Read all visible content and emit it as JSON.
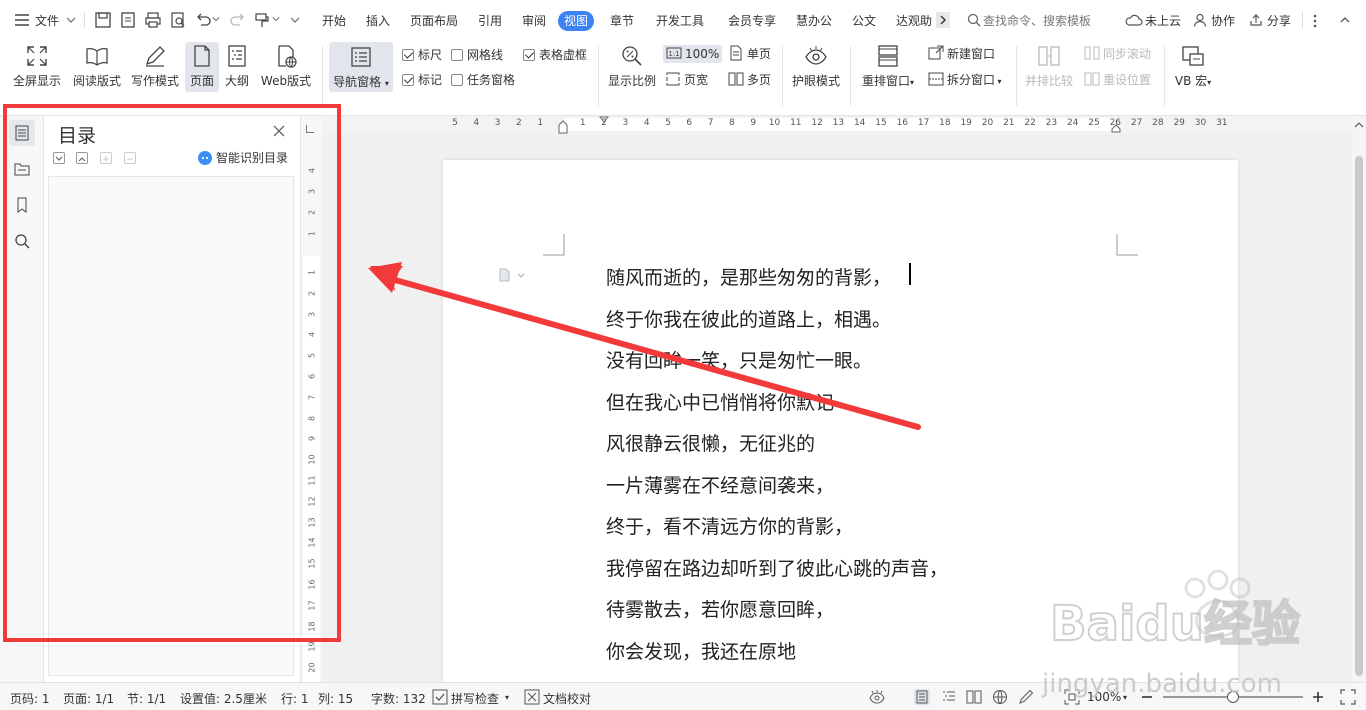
{
  "menubar": {
    "file_menu": "文件",
    "tabs": [
      {
        "label": "开始",
        "active": false
      },
      {
        "label": "插入",
        "active": false
      },
      {
        "label": "页面布局",
        "active": false
      },
      {
        "label": "引用",
        "active": false
      },
      {
        "label": "审阅",
        "active": false
      },
      {
        "label": "视图",
        "active": true
      },
      {
        "label": "章节",
        "active": false
      },
      {
        "label": "开发工具",
        "active": false
      },
      {
        "label": "会员专享",
        "active": false
      },
      {
        "label": "慧办公",
        "active": false
      },
      {
        "label": "公文",
        "active": false
      },
      {
        "label": "达观助",
        "active": false
      }
    ],
    "search_placeholder": "查找命令、搜索模板",
    "cloud_status": "未上云",
    "collaborate": "协作",
    "share": "分享"
  },
  "ribbon": {
    "fullscreen": "全屏显示",
    "reading_layout": "阅读版式",
    "writing_mode": "写作模式",
    "page_view": "页面",
    "outline": "大纲",
    "web_layout": "Web版式",
    "nav_pane": "导航窗格",
    "checks": {
      "ruler": {
        "label": "标尺",
        "checked": true
      },
      "gridlines": {
        "label": "网格线",
        "checked": false
      },
      "table_gridlines": {
        "label": "表格虚框",
        "checked": true
      },
      "marks": {
        "label": "标记",
        "checked": true
      },
      "task_pane": {
        "label": "任务窗格",
        "checked": false
      }
    },
    "zoom_ratio": "显示比例",
    "zoom_100": "100%",
    "page_width": "页宽",
    "single_page": "单页",
    "multi_page": "多页",
    "eye_protect": "护眼模式",
    "rearrange": "重排窗口",
    "new_window": "新建窗口",
    "split_window": "拆分窗口",
    "side_by_side": "并排比较",
    "sync_scroll": "同步滚动",
    "reset_position": "重设位置",
    "macro": "VB 宏"
  },
  "toc_panel": {
    "title": "目录",
    "smart_detect": "智能识别目录"
  },
  "ruler": {
    "horizontal": [
      "5",
      "4",
      "3",
      "2",
      "1",
      "",
      "1",
      "2",
      "3",
      "4",
      "5",
      "6",
      "7",
      "8",
      "9",
      "10",
      "11",
      "12",
      "13",
      "14",
      "15",
      "16",
      "17",
      "18",
      "19",
      "20",
      "21",
      "22",
      "23",
      "24",
      "25",
      "26",
      "27",
      "28",
      "29",
      "30",
      "31"
    ],
    "vertical_top": [
      "4",
      "3",
      "2",
      "1"
    ],
    "vertical_main": [
      "1",
      "2",
      "3",
      "4",
      "5",
      "6",
      "7",
      "8",
      "9",
      "10",
      "11",
      "12",
      "13",
      "14",
      "15",
      "16",
      "17",
      "18",
      "19",
      "20"
    ]
  },
  "document": {
    "lines": [
      "随风而逝的，是那些匆匆的背影，",
      "终于你我在彼此的道路上，相遇。",
      "没有回眸一笑，只是匆忙一眼。",
      "但在我心中已悄悄将你默记",
      "风很静云很懒，无征兆的",
      "一片薄雾在不经意间袭来，",
      "终于，看不清远方你的背影，",
      "我停留在路边却听到了彼此心跳的声音，",
      "待雾散去，若你愿意回眸，",
      "你会发现，我还在原地"
    ]
  },
  "statusbar": {
    "page_num": "页码: 1",
    "pages": "页面: 1/1",
    "section": "节: 1/1",
    "setting": "设置值: 2.5厘米",
    "row": "行: 1",
    "col": "列: 15",
    "word_count": "字数: 132",
    "spell_check": "拼写检查",
    "doc_proof": "文档校对",
    "zoom": "100%",
    "zoom_level": 0.5
  },
  "watermark": {
    "brand": "Baidu经验",
    "url": "jingyan.baidu.com"
  },
  "colors": {
    "accent": "#3b82f6",
    "annotation": "#f33a3a"
  }
}
